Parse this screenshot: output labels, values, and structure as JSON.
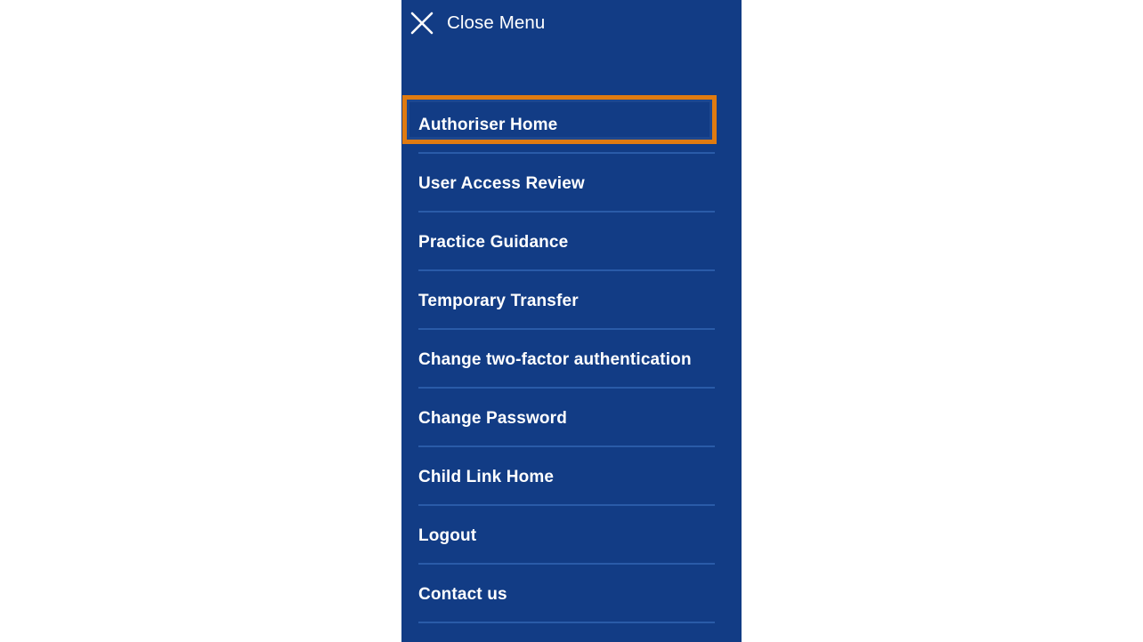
{
  "panel": {
    "background_color": "#123c85",
    "highlight_color": "#e07b10",
    "separator_color": "#2a5ba8",
    "text_color": "#ffffff"
  },
  "header": {
    "close_label": "Close Menu",
    "close_icon": "close-x-icon"
  },
  "menu": {
    "items": [
      {
        "label": "Authoriser Home",
        "highlighted": true
      },
      {
        "label": "User Access Review",
        "highlighted": false
      },
      {
        "label": "Practice Guidance",
        "highlighted": false
      },
      {
        "label": "Temporary Transfer",
        "highlighted": false
      },
      {
        "label": "Change two-factor authentication",
        "highlighted": false
      },
      {
        "label": "Change Password",
        "highlighted": false
      },
      {
        "label": "Child Link Home",
        "highlighted": false
      },
      {
        "label": "Logout",
        "highlighted": false
      },
      {
        "label": "Contact us",
        "highlighted": false
      }
    ]
  }
}
